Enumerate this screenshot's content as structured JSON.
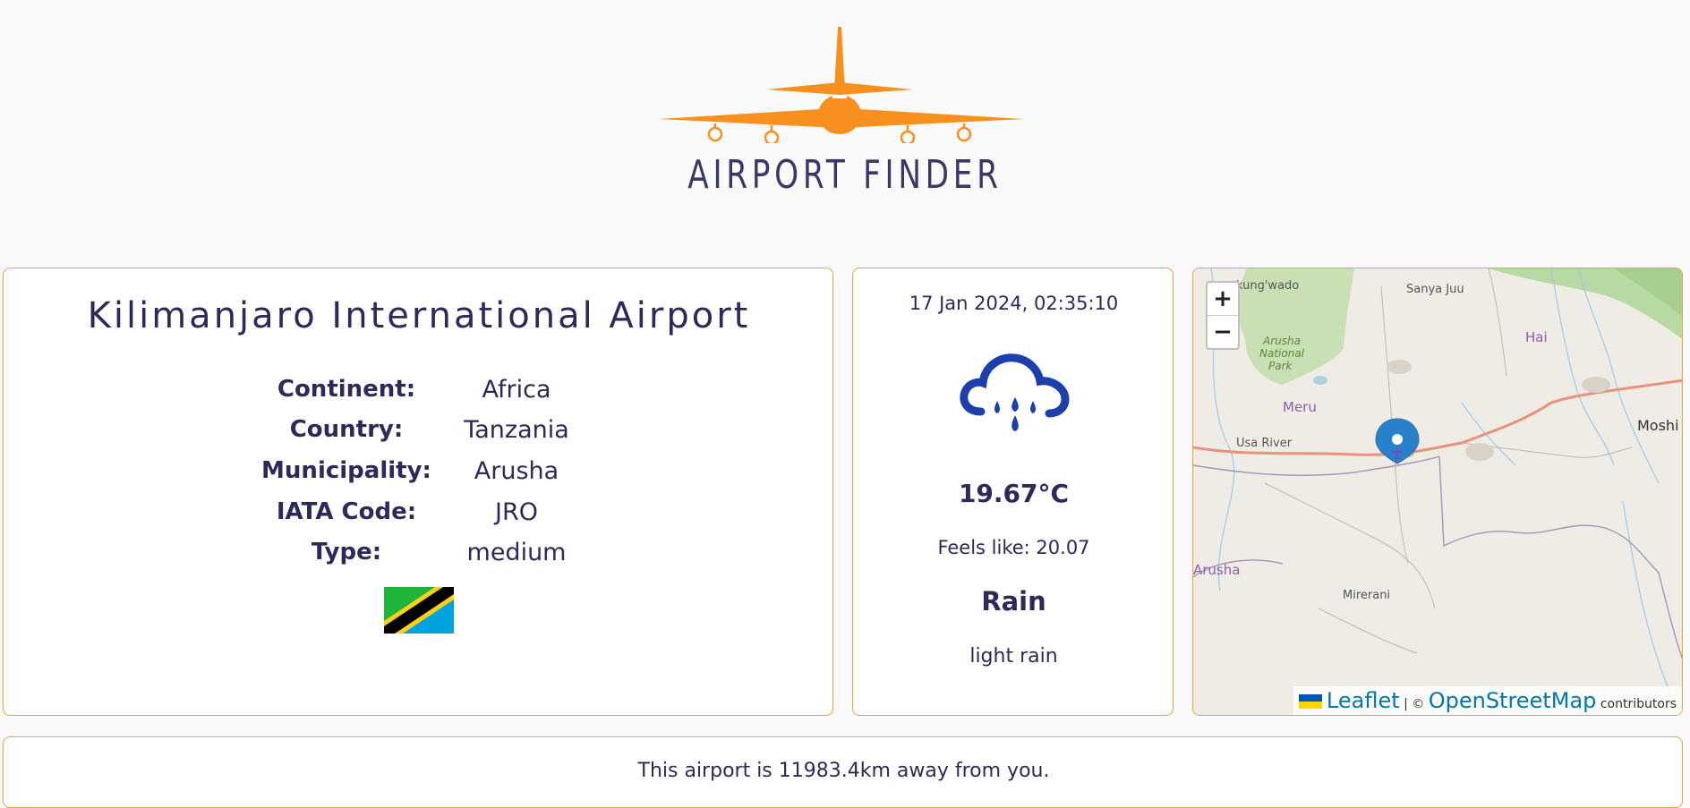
{
  "header": {
    "logo_text": "AIRPORT FINDER",
    "logo_color": "#f7901e"
  },
  "airport": {
    "name": "Kilimanjaro International Airport",
    "fields": [
      {
        "label": "Continent:",
        "value": "Africa"
      },
      {
        "label": "Country:",
        "value": "Tanzania"
      },
      {
        "label": "Municipality:",
        "value": "Arusha"
      },
      {
        "label": "IATA Code:",
        "value": "JRO"
      },
      {
        "label": "Type:",
        "value": "medium"
      }
    ],
    "flag_icon": "tanzania-flag"
  },
  "weather": {
    "datetime": "17 Jan 2024, 02:35:10",
    "icon": "rain-cloud-icon",
    "temperature": "19.67°C",
    "feels_like": "Feels like: 20.07",
    "main": "Rain",
    "description": "light rain"
  },
  "map": {
    "zoom_in": "+",
    "zoom_out": "−",
    "attribution_leaflet": "Leaflet",
    "attribution_sep": "| ©",
    "attribution_osm": "OpenStreetMap",
    "attribution_contrib": "contributors",
    "labels": {
      "kungwado": "kung'wado",
      "sanya_juu": "Sanya Juu",
      "arusha_np": "Arusha",
      "national": "National",
      "park": "Park",
      "hai": "Hai",
      "meru": "Meru",
      "moshi": "Moshi",
      "usa_river": "Usa River",
      "arusha": "Arusha",
      "mirerani": "Mirerani"
    }
  },
  "distance": {
    "text": "This airport is 11983.4km away from you."
  }
}
